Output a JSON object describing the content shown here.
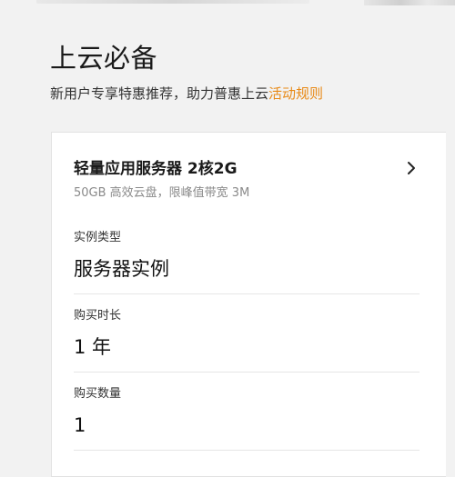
{
  "section": {
    "title": "上云必备",
    "subtitle_text": "新用户专享特惠推荐，助力普惠上云",
    "subtitle_link": "活动规则"
  },
  "product": {
    "name": "轻量应用服务器 2核2G",
    "description": "50GB 高效云盘，限峰值带宽 3M"
  },
  "fields": [
    {
      "label": "实例类型",
      "value": "服务器实例"
    },
    {
      "label": "购买时长",
      "value": "1 年"
    },
    {
      "label": "购买数量",
      "value": "1"
    }
  ],
  "colors": {
    "link": "#e88a17",
    "background": "#f2f2f2",
    "card": "#ffffff"
  }
}
